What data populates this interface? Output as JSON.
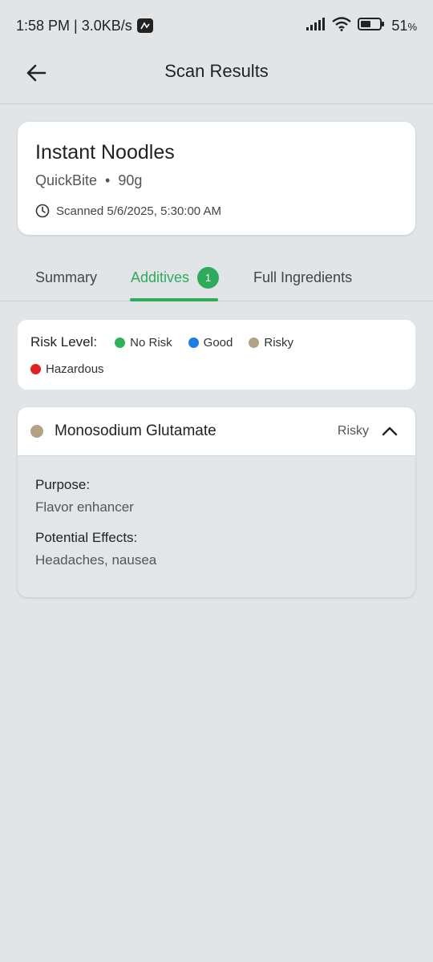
{
  "status_bar": {
    "time_speed": "1:58 PM | 3.0KB/s",
    "battery": "51"
  },
  "header": {
    "title": "Scan Results"
  },
  "product": {
    "name": "Instant Noodles",
    "brand": "QuickBite",
    "separator": "•",
    "weight": "90g",
    "scanned": "Scanned 5/6/2025, 5:30:00 AM"
  },
  "tabs": [
    {
      "label": "Summary"
    },
    {
      "label": "Additives",
      "badge": "1"
    },
    {
      "label": "Full Ingredients"
    }
  ],
  "legend": {
    "title": "Risk Level:",
    "items": [
      {
        "label": "No Risk",
        "color": "#2eb35c"
      },
      {
        "label": "Good",
        "color": "#1e7fe0"
      },
      {
        "label": "Risky",
        "color": "#b3a384"
      },
      {
        "label": "Hazardous",
        "color": "#e02222"
      }
    ]
  },
  "additive": {
    "name": "Monosodium Glutamate",
    "risk": "Risky",
    "color": "#b3a384",
    "purpose_label": "Purpose:",
    "purpose": "Flavor enhancer",
    "effects_label": "Potential Effects:",
    "effects": "Headaches, nausea"
  }
}
